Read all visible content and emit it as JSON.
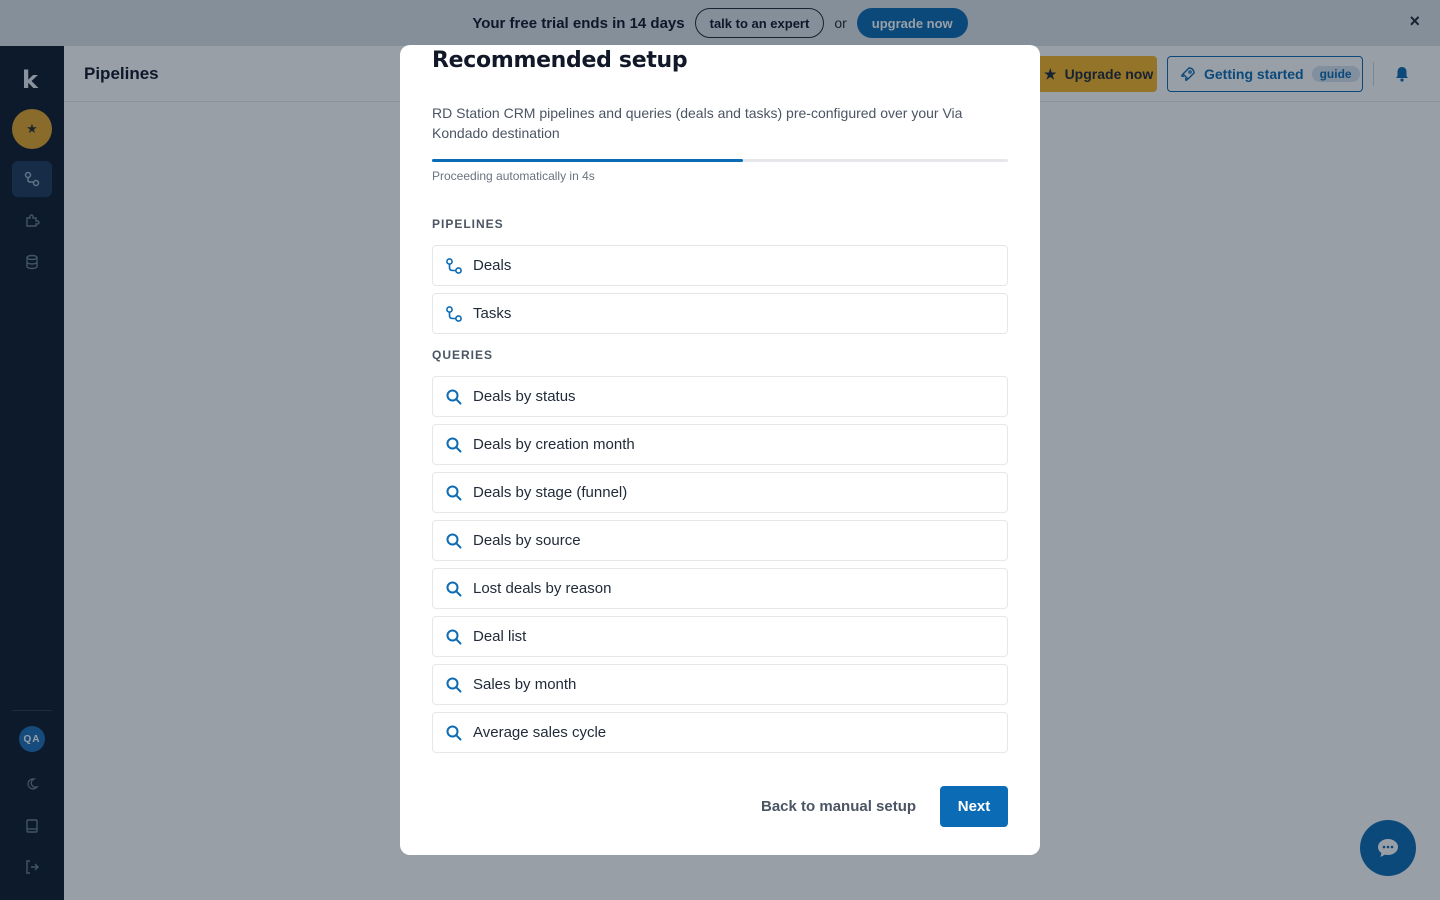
{
  "banner": {
    "text": "Your free trial ends in 14 days",
    "expert_label": "talk to an expert",
    "or_label": "or",
    "upgrade_label": "upgrade now",
    "close_icon": "×"
  },
  "sidebar": {
    "logo": "k",
    "star_icon": "★",
    "user_initials": "QA"
  },
  "topbar": {
    "title": "Pipelines",
    "upgrade_label": "Upgrade now",
    "upgrade_icon": "★",
    "getting_started_label": "Getting started",
    "guide_badge": "guide"
  },
  "modal": {
    "title": "Recommended setup",
    "subtitle": "RD Station CRM pipelines and queries (deals and tasks) pre-configured over your Via Kondado destination",
    "progress_fraction": 0.54,
    "progress_text": "Proceeding automatically in 4s",
    "pipelines_label": "PIPELINES",
    "pipelines": [
      "Deals",
      "Tasks"
    ],
    "queries_label": "QUERIES",
    "queries": [
      "Deals by status",
      "Deals by creation month",
      "Deals by stage (funnel)",
      "Deals by source",
      "Lost deals by reason",
      "Deal list",
      "Sales by month",
      "Average sales cycle"
    ],
    "back_label": "Back to manual setup",
    "next_label": "Next"
  },
  "colors": {
    "brand": "#0b6bb5",
    "accent": "#f6b626",
    "sidebar_bg": "#0d1a2b"
  }
}
